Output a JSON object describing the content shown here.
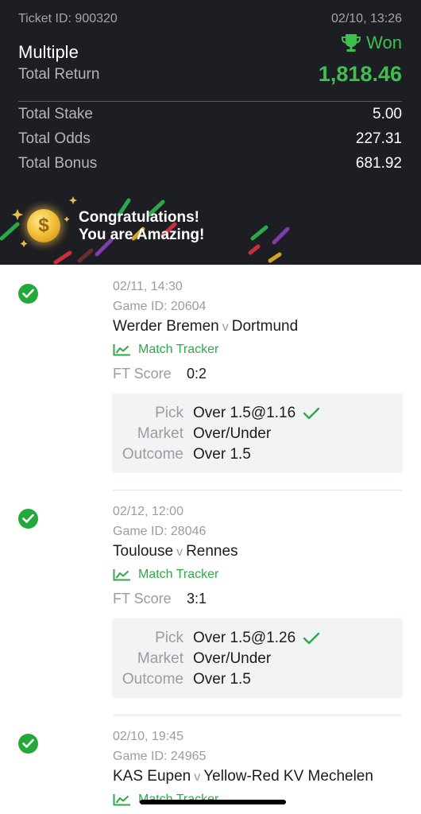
{
  "ticket": {
    "id_label": "Ticket ID: 900320",
    "datetime": "02/10, 13:26",
    "status": "Won",
    "bet_type": "Multiple",
    "total_return_label": "Total Return",
    "total_return": "1,818.46",
    "rows": [
      {
        "label": "Total Stake",
        "value": "5.00"
      },
      {
        "label": "Total Odds",
        "value": "227.31"
      },
      {
        "label": "Total Bonus",
        "value": "681.92"
      }
    ],
    "banner_line1": "Congratulations!",
    "banner_line2": "You are Amazing!",
    "coin_symbol": "$"
  },
  "labels": {
    "match_tracker": "Match Tracker",
    "ft_score": "FT Score",
    "pick": "Pick",
    "market": "Market",
    "outcome": "Outcome",
    "vs": "v"
  },
  "selections": [
    {
      "date": "02/11, 14:30",
      "game_id": "Game ID: 20604",
      "home": "Werder Bremen",
      "away": "Dortmund",
      "ft_score": "0:2",
      "pick": "Over 1.5@1.16",
      "market": "Over/Under",
      "outcome": "Over 1.5"
    },
    {
      "date": "02/12, 12:00",
      "game_id": "Game ID: 28046",
      "home": "Toulouse",
      "away": "Rennes",
      "ft_score": "3:1",
      "pick": "Over 1.5@1.26",
      "market": "Over/Under",
      "outcome": "Over 1.5"
    },
    {
      "date": "02/10, 19:45",
      "game_id": "Game ID: 24965",
      "home": "KAS Eupen",
      "away": "Yellow-Red KV Mechelen",
      "ft_score": "",
      "pick": "",
      "market": "",
      "outcome": ""
    }
  ],
  "colors": {
    "header_bg": "#1d1e23",
    "won_green": "#3fbf4f",
    "check_green": "#23a93a",
    "tracker_green": "#2fa84a"
  },
  "icons": {
    "status": "trophy-icon",
    "selection_status": "check-circle-icon",
    "tracker": "line-chart-icon",
    "pick_result": "checkmark-icon",
    "banner": "coin-icon"
  }
}
